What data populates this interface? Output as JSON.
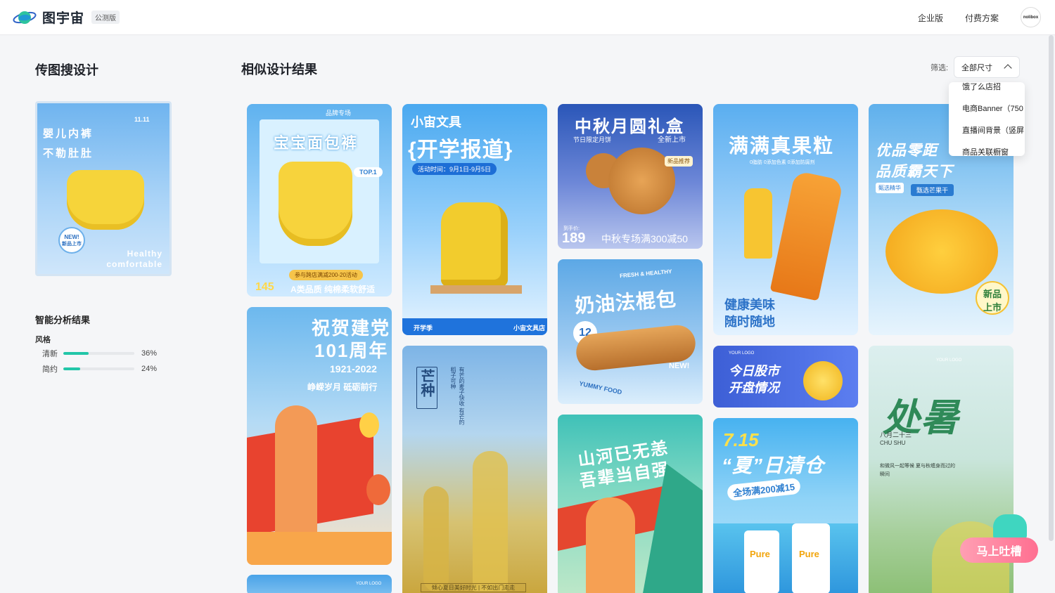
{
  "app": {
    "name": "图宇宙",
    "badge": "公测版"
  },
  "nav": {
    "enterprise": "企业版",
    "pricing": "付费方案",
    "avatar_text": "nolibox"
  },
  "left": {
    "title": "传图搜设计",
    "query_image": {
      "line1": "婴儿内裤",
      "line2": "不勒肚肚",
      "badge_new": "NEW!",
      "badge_cn": "新品上市",
      "tail1": "Healthy",
      "tail2": "comfortable",
      "date": "11.11"
    },
    "analysis_title": "智能分析结果",
    "style_title": "风格",
    "styles": [
      {
        "label": "清新",
        "value": "36%",
        "ratio": 0.36
      },
      {
        "label": "简约",
        "value": "24%",
        "ratio": 0.24
      }
    ]
  },
  "results": {
    "title": "相似设计结果",
    "filter_label": "筛选:",
    "filter_value": "全部尺寸",
    "filter_options": [
      "饿了么店招",
      "电商Banner（750",
      "直播间背景（竖屏",
      "商品关联橱窗"
    ]
  },
  "cards": {
    "c1": {
      "tag": "品牌专场",
      "headline": "宝宝面包裤",
      "top": "TOP.1",
      "promo": "参与跨店满减200-20活动",
      "price": "145",
      "desc": "A类品质 纯棉柔软舒适"
    },
    "c2": {
      "line1": "祝贺建党",
      "line2": "101周年",
      "years": "1921-2022",
      "sub": "峥嵘岁月 砥砺前行"
    },
    "c3": {
      "title": "小宙文具",
      "headline": "{开学报道}",
      "date": "活动时间：9月1日-9月5日",
      "foot_left": "开学季",
      "foot_right": "小宙文具店"
    },
    "c4": {
      "title": "芒种",
      "verse": "有芒的麦子快收 有芒的稻子可种",
      "foot": "倾心夏日美好时光 | 不如出门走走"
    },
    "c5": {
      "headline": "中秋月圆礼盒",
      "sub_left": "节日限定月饼",
      "sub_right": "全新上市",
      "badge": "新品推荐",
      "price_label": "到手价:",
      "price": "189",
      "promo": "中秋专场满300减50"
    },
    "c6": {
      "tag": "FRESH & HEALTHY",
      "headline": "奶油法棍包",
      "price": "12",
      "new": "NEW!",
      "yummy": "YUMMY FOOD"
    },
    "c7": {
      "line1": "山河已无恙",
      "line2": "吾辈当自强"
    },
    "c8": {
      "headline": "满满真果粒",
      "sub": "0脂肪 0添加色素 0添加防腐剂",
      "line1": "健康美味",
      "line2": "随时随地"
    },
    "c9": {
      "logo": "YOUR LOGO",
      "line1": "今日股市",
      "line2": "开盘情况"
    },
    "c10": {
      "date": "7.15",
      "headline": "“夏”日清仓",
      "sub": "全场满200减15",
      "brand": "Pure"
    },
    "c11": {
      "line1": "优品零距",
      "line2": "品质霸天下",
      "tag1": "甄选精华",
      "tag2": "甄选芒果干",
      "badge1": "新品",
      "badge2": "上市"
    },
    "c12": {
      "logo": "YOUR LOGO",
      "headline": "处暑",
      "date": "八月二十三",
      "pinyin": "CHU SHU",
      "desc": "和微风一起等候 夏与秋缠身而过的瞬间"
    },
    "c13": {
      "logo": "YOUR LOGO"
    }
  },
  "feedback": {
    "label": "马上吐槽"
  },
  "colors": {
    "accent": "#22c6a8",
    "feedback": "#ff6f91"
  }
}
